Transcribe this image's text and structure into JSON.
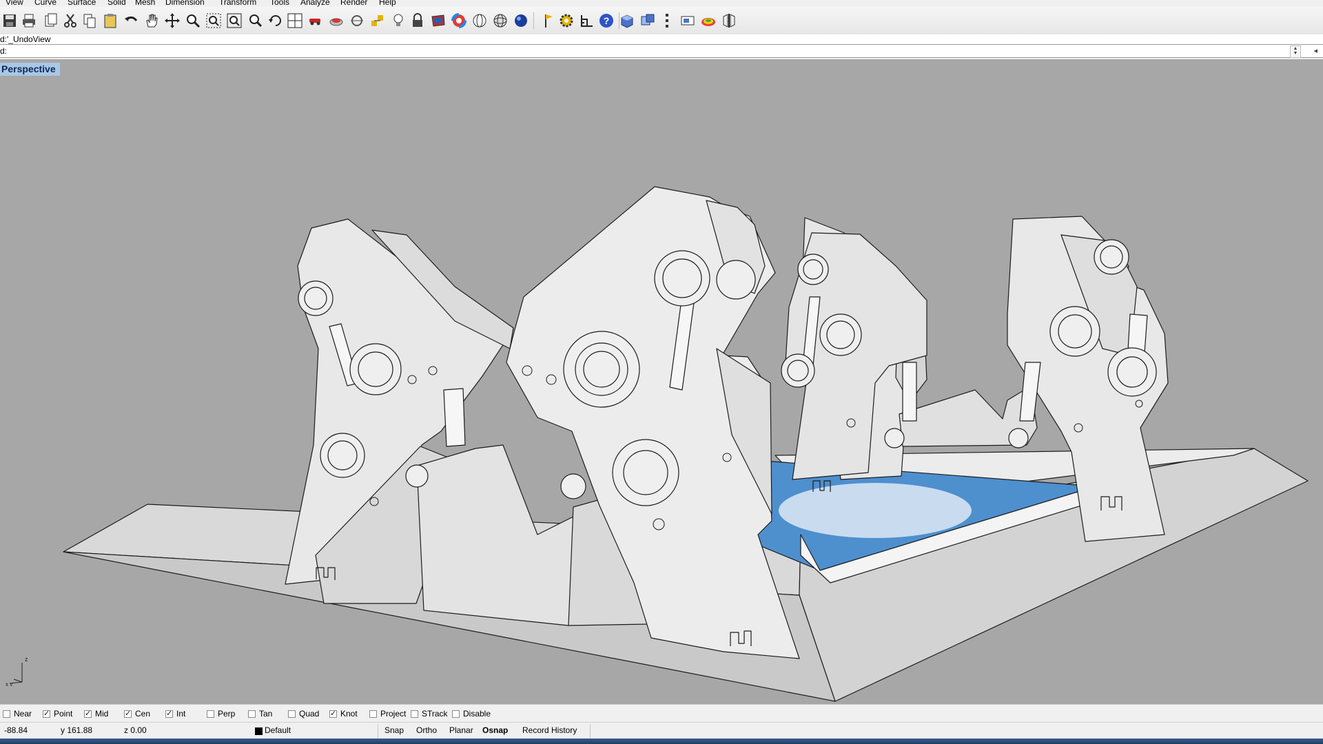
{
  "menu": [
    "View",
    "Curve",
    "Surface",
    "Solid",
    "Mesh",
    "Dimension",
    "Transform",
    "Tools",
    "Analyze",
    "Render",
    "Help"
  ],
  "toolbar_icons": [
    "save-icon",
    "print-icon",
    "copy-to-clipboard-icon",
    "cut-icon",
    "copy-icon",
    "paste-icon",
    "undo-icon",
    "pan-icon",
    "rotate-view-icon",
    "zoom-icon",
    "zoom-window-icon",
    "zoom-extents-icon",
    "zoom-selected-icon",
    "undo-view-icon",
    "four-viewports-icon",
    "named-view-icon",
    "shade-icon",
    "point-icon",
    "snap-icon",
    "light-icon",
    "lock-icon",
    "layer-icon",
    "color-icon",
    "sphere-wire-icon",
    "mesh-sphere-icon",
    "render-sphere-icon",
    "flag-icon",
    "options-gear-icon",
    "grid-icon",
    "help-icon",
    "box-icon",
    "viewport-icon",
    "properties-icon",
    "display-icon",
    "analysis-icon",
    "mirror-icon"
  ],
  "command_history": "d:'_UndoView",
  "command_prompt": "d:",
  "command_input": "",
  "viewport": {
    "title": "Perspective",
    "axis_z": "z",
    "axis_xy": "x y"
  },
  "osnaps": [
    {
      "label": "Near",
      "checked": false
    },
    {
      "label": "Point",
      "checked": true
    },
    {
      "label": "Mid",
      "checked": true
    },
    {
      "label": "Cen",
      "checked": true
    },
    {
      "label": "Int",
      "checked": true
    },
    {
      "label": "Perp",
      "checked": false
    },
    {
      "label": "Tan",
      "checked": false
    },
    {
      "label": "Quad",
      "checked": false
    },
    {
      "label": "Knot",
      "checked": true
    },
    {
      "label": "Project",
      "checked": false
    },
    {
      "label": "STrack",
      "checked": false
    },
    {
      "label": "Disable",
      "checked": false
    }
  ],
  "status": {
    "x": "-88.84",
    "y": "y 161.88",
    "z": "z 0.00",
    "layer": "Default",
    "snap": "Snap",
    "ortho": "Ortho",
    "planar": "Planar",
    "osnap": "Osnap",
    "record_history": "Record History"
  },
  "colors": {
    "viewport_bg": "#a7a7a7",
    "model_face": "#e9e9e9",
    "plate_blue": "#4e8fce",
    "viewport_title_bg": "#a9c7e6"
  }
}
